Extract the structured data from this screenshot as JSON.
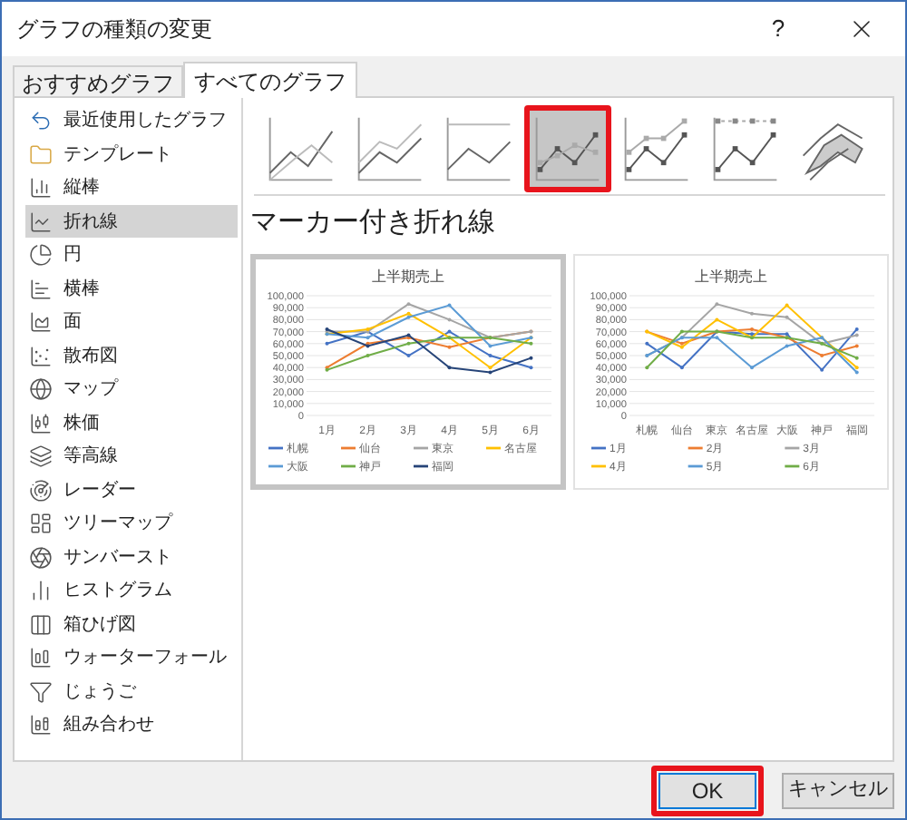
{
  "window": {
    "title": "グラフの種類の変更",
    "help_button": "?"
  },
  "tabs": [
    {
      "label": "おすすめグラフ",
      "selected": false
    },
    {
      "label": "すべてのグラフ",
      "selected": true
    }
  ],
  "sidebar": {
    "items": [
      {
        "label": "最近使用したグラフ",
        "selected": false
      },
      {
        "label": "テンプレート",
        "selected": false
      },
      {
        "label": "縦棒",
        "selected": false
      },
      {
        "label": "折れ線",
        "selected": true
      },
      {
        "label": "円",
        "selected": false
      },
      {
        "label": "横棒",
        "selected": false
      },
      {
        "label": "面",
        "selected": false
      },
      {
        "label": "散布図",
        "selected": false
      },
      {
        "label": "マップ",
        "selected": false
      },
      {
        "label": "株価",
        "selected": false
      },
      {
        "label": "等高線",
        "selected": false
      },
      {
        "label": "レーダー",
        "selected": false
      },
      {
        "label": "ツリーマップ",
        "selected": false
      },
      {
        "label": "サンバースト",
        "selected": false
      },
      {
        "label": "ヒストグラム",
        "selected": false
      },
      {
        "label": "箱ひげ図",
        "selected": false
      },
      {
        "label": "ウォーターフォール",
        "selected": false
      },
      {
        "label": "じょうご",
        "selected": false
      },
      {
        "label": "組み合わせ",
        "selected": false
      }
    ]
  },
  "subtypes": [
    {
      "selected": false
    },
    {
      "selected": false
    },
    {
      "selected": false
    },
    {
      "selected": true
    },
    {
      "selected": false
    },
    {
      "selected": false
    },
    {
      "selected": false
    }
  ],
  "heading": "マーカー付き折れ線",
  "previews": [
    {
      "selected": true,
      "chart_data": {
        "type": "line",
        "grid": true,
        "legend": "bottom",
        "title": "上半期売上",
        "categories": [
          "1月",
          "2月",
          "3月",
          "4月",
          "5月",
          "6月"
        ],
        "ylim": [
          0,
          100000
        ],
        "yticks": [
          {
            "value": 0,
            "label": "0"
          },
          {
            "value": 10000,
            "label": "10,000"
          },
          {
            "value": 20000,
            "label": "20,000"
          },
          {
            "value": 30000,
            "label": "30,000"
          },
          {
            "value": 40000,
            "label": "40,000"
          },
          {
            "value": 50000,
            "label": "50,000"
          },
          {
            "value": 60000,
            "label": "60,000"
          },
          {
            "value": 70000,
            "label": "70,000"
          },
          {
            "value": 80000,
            "label": "80,000"
          },
          {
            "value": 90000,
            "label": "90,000"
          },
          {
            "value": 100000,
            "label": "100,000"
          }
        ],
        "series": [
          {
            "name": "札幌",
            "color": "#4472c4",
            "values": [
              60000,
              70000,
              50000,
              70000,
              50000,
              40000
            ]
          },
          {
            "name": "仙台",
            "color": "#ed7d31",
            "values": [
              40000,
              60000,
              65000,
              57000,
              65000,
              70000
            ]
          },
          {
            "name": "東京",
            "color": "#a5a5a5",
            "values": [
              70000,
              70000,
              93000,
              80000,
              65000,
              70000
            ]
          },
          {
            "name": "名古屋",
            "color": "#ffc000",
            "values": [
              68000,
              72000,
              85000,
              65000,
              40000,
              65000
            ]
          },
          {
            "name": "大阪",
            "color": "#5b9bd5",
            "values": [
              68000,
              65000,
              82000,
              92000,
              58000,
              65000
            ]
          },
          {
            "name": "神戸",
            "color": "#70ad47",
            "values": [
              38000,
              50000,
              60000,
              65000,
              65000,
              60000
            ]
          },
          {
            "name": "福岡",
            "color": "#264478",
            "values": [
              72000,
              58000,
              67000,
              40000,
              36000,
              48000
            ]
          }
        ]
      }
    },
    {
      "selected": false,
      "chart_data": {
        "type": "line",
        "grid": true,
        "legend": "bottom",
        "title": "上半期売上",
        "categories": [
          "札幌",
          "仙台",
          "東京",
          "名古屋",
          "大阪",
          "神戸",
          "福岡"
        ],
        "ylim": [
          0,
          100000
        ],
        "yticks": [
          {
            "value": 0,
            "label": "0"
          },
          {
            "value": 10000,
            "label": "10,000"
          },
          {
            "value": 20000,
            "label": "20,000"
          },
          {
            "value": 30000,
            "label": "30,000"
          },
          {
            "value": 40000,
            "label": "40,000"
          },
          {
            "value": 50000,
            "label": "50,000"
          },
          {
            "value": 60000,
            "label": "60,000"
          },
          {
            "value": 70000,
            "label": "70,000"
          },
          {
            "value": 80000,
            "label": "80,000"
          },
          {
            "value": 90000,
            "label": "90,000"
          },
          {
            "value": 100000,
            "label": "100,000"
          }
        ],
        "series": [
          {
            "name": "1月",
            "color": "#4472c4",
            "values": [
              60000,
              40000,
              70000,
              68000,
              68000,
              38000,
              72000
            ]
          },
          {
            "name": "2月",
            "color": "#ed7d31",
            "values": [
              70000,
              60000,
              70000,
              72000,
              65000,
              50000,
              58000
            ]
          },
          {
            "name": "3月",
            "color": "#a5a5a5",
            "values": [
              50000,
              65000,
              93000,
              85000,
              82000,
              60000,
              67000
            ]
          },
          {
            "name": "4月",
            "color": "#ffc000",
            "values": [
              70000,
              57000,
              80000,
              65000,
              92000,
              65000,
              40000
            ]
          },
          {
            "name": "5月",
            "color": "#5b9bd5",
            "values": [
              50000,
              65000,
              65000,
              40000,
              58000,
              65000,
              36000
            ]
          },
          {
            "name": "6月",
            "color": "#70ad47",
            "values": [
              40000,
              70000,
              70000,
              65000,
              65000,
              60000,
              48000
            ]
          }
        ]
      }
    }
  ],
  "buttons": [
    {
      "label": "OK",
      "kind": "primary",
      "highlighted": true
    },
    {
      "label": "キャンセル",
      "kind": "secondary",
      "highlighted": false
    }
  ]
}
